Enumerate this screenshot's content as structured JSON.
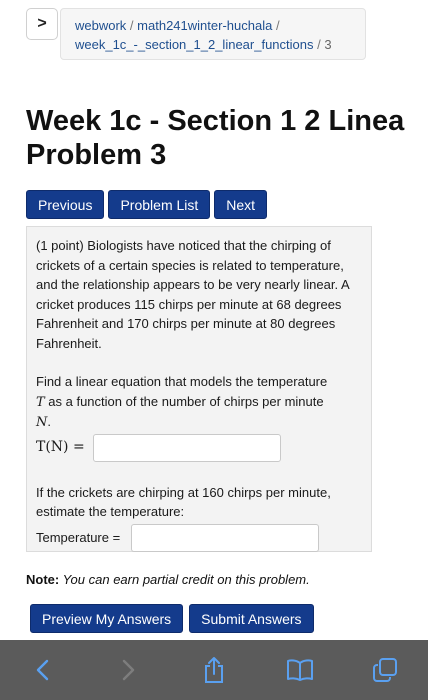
{
  "breadcrumb": {
    "toggle": ">",
    "course": "webwork",
    "sep1": "/",
    "section": "math241winter-huchala",
    "sep2": "/",
    "set": "week_1c_-_section_1_2_linear_functions",
    "sep3": "/",
    "problem": "3"
  },
  "page": {
    "title_line1": "Week 1c - Section 1 2 Linea",
    "title_line2": "Problem 3"
  },
  "nav": {
    "previous": "Previous",
    "problem_list": "Problem List",
    "next": "Next"
  },
  "problem": {
    "lines_intro": [
      "(1 point) Biologists have noticed that the chirping of",
      "crickets of a certain species is related to temperature,",
      "and the relationship appears to be very nearly linear. A",
      "cricket produces 115 chirps per minute at 68 degrees",
      "Fahrenheit and 170 chirps per minute at 80 degrees",
      "Fahrenheit."
    ],
    "q1_line1": "Find a linear equation that models the temperature",
    "q1_T": "T",
    "q1_line2_rest": " as a function of the number of chirps per minute",
    "q1_N": "N",
    "q1_period": ".",
    "tn_label": "T(N) =",
    "q2_line1": "If the crickets are chirping at 160 chirps per minute,",
    "q2_line2": "estimate the temperature:",
    "temp_label": "Temperature ="
  },
  "note": {
    "label": "Note:",
    "text": " You can earn partial credit on this problem."
  },
  "actions": {
    "preview": "Preview My Answers",
    "submit": "Submit Answers"
  },
  "toolbar": {
    "icons": [
      "back-icon",
      "forward-icon",
      "share-icon",
      "bookmarks-icon",
      "tabs-icon"
    ],
    "icon_color": "#5aa0f0",
    "disabled_color": "#7d7d7d",
    "background": "#5b5b5b"
  },
  "colors": {
    "button_bg": "#143b8c",
    "link": "#1f4f8f",
    "panel_bg": "#f3f3f3"
  }
}
